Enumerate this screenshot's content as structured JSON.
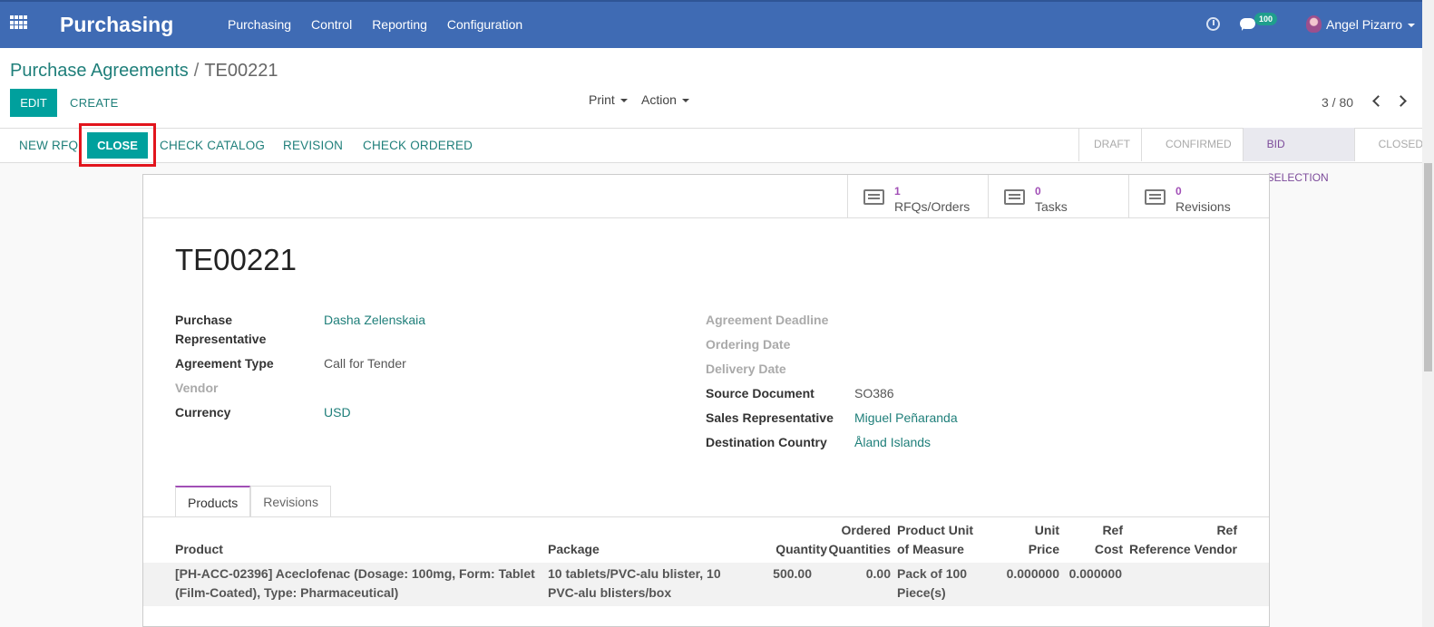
{
  "app": {
    "title": "Purchasing"
  },
  "menu": [
    "Purchasing",
    "Control",
    "Reporting",
    "Configuration"
  ],
  "systray": {
    "messages_badge": "100",
    "user_name": "Angel Pizarro"
  },
  "breadcrumb": {
    "parent": "Purchase Agreements",
    "separator": "/",
    "current": "TE00221"
  },
  "toolbar": {
    "edit_label": "EDIT",
    "create_label": "CREATE",
    "print_label": "Print",
    "action_label": "Action"
  },
  "pager": {
    "value": "3 / 80"
  },
  "statusbar": {
    "buttons": [
      "NEW RFQ",
      "CLOSE",
      "CHECK CATALOG",
      "REVISION",
      "CHECK ORDERED"
    ],
    "stages": [
      "DRAFT",
      "CONFIRMED",
      "BID SELECTION",
      "CLOSED"
    ],
    "active_stage": "BID SELECTION"
  },
  "smart_buttons": [
    {
      "count": "1",
      "label": "RFQs/Orders",
      "icon": "list-icon"
    },
    {
      "count": "0",
      "label": "Tasks",
      "icon": "tasks-icon"
    },
    {
      "count": "0",
      "label": "Revisions",
      "icon": "list-icon"
    }
  ],
  "record": {
    "name": "TE00221",
    "left_fields": [
      {
        "label_line1": "Purchase",
        "label_line2": "Representative",
        "value": "Dasha Zelenskaia"
      },
      {
        "label": "Agreement Type",
        "value": "Call for Tender"
      },
      {
        "label": "Vendor",
        "value": ""
      },
      {
        "label": "Currency",
        "value": "USD"
      }
    ],
    "right_fields": [
      {
        "label": "Agreement Deadline",
        "value": ""
      },
      {
        "label": "Ordering Date",
        "value": ""
      },
      {
        "label": "Delivery Date",
        "value": ""
      },
      {
        "label": "Source Document",
        "value": "SO386"
      },
      {
        "label": "Sales Representative",
        "value": "Miguel Peñaranda"
      },
      {
        "label": "Destination Country",
        "value": "Åland Islands"
      }
    ]
  },
  "tabs": [
    "Products",
    "Revisions"
  ],
  "table": {
    "headers": {
      "product": "Product",
      "package": "Package",
      "quantity": "Quantity",
      "ordered_1": "Ordered",
      "ordered_2": "Quantities",
      "uom_1": "Product Unit",
      "uom_2": "of Measure",
      "price_1": "Unit",
      "price_2": "Price",
      "refcost_1": "Ref",
      "refcost_2": "Cost",
      "reference": "Reference",
      "refvendor_1": "Ref",
      "refvendor_2": "Vendor"
    },
    "rows": [
      {
        "product_1": "[PH-ACC-02396] Aceclofenac (Dosage: 100mg, Form: Tablet",
        "product_2": "(Film-Coated), Type: Pharmaceutical)",
        "package_1": "10 tablets/PVC-alu blister, 10",
        "package_2": "PVC-alu blisters/box",
        "quantity": "500.00",
        "ordered": "0.00",
        "uom_1": "Pack of 100",
        "uom_2": "Piece(s)",
        "unit_price": "0.000000",
        "ref_cost": "0.000000"
      }
    ]
  },
  "colors": {
    "navbar": "#3f6bb4",
    "primary": "#00a09d",
    "accent": "#a14fb6",
    "highlight_box": "#e2151d"
  }
}
